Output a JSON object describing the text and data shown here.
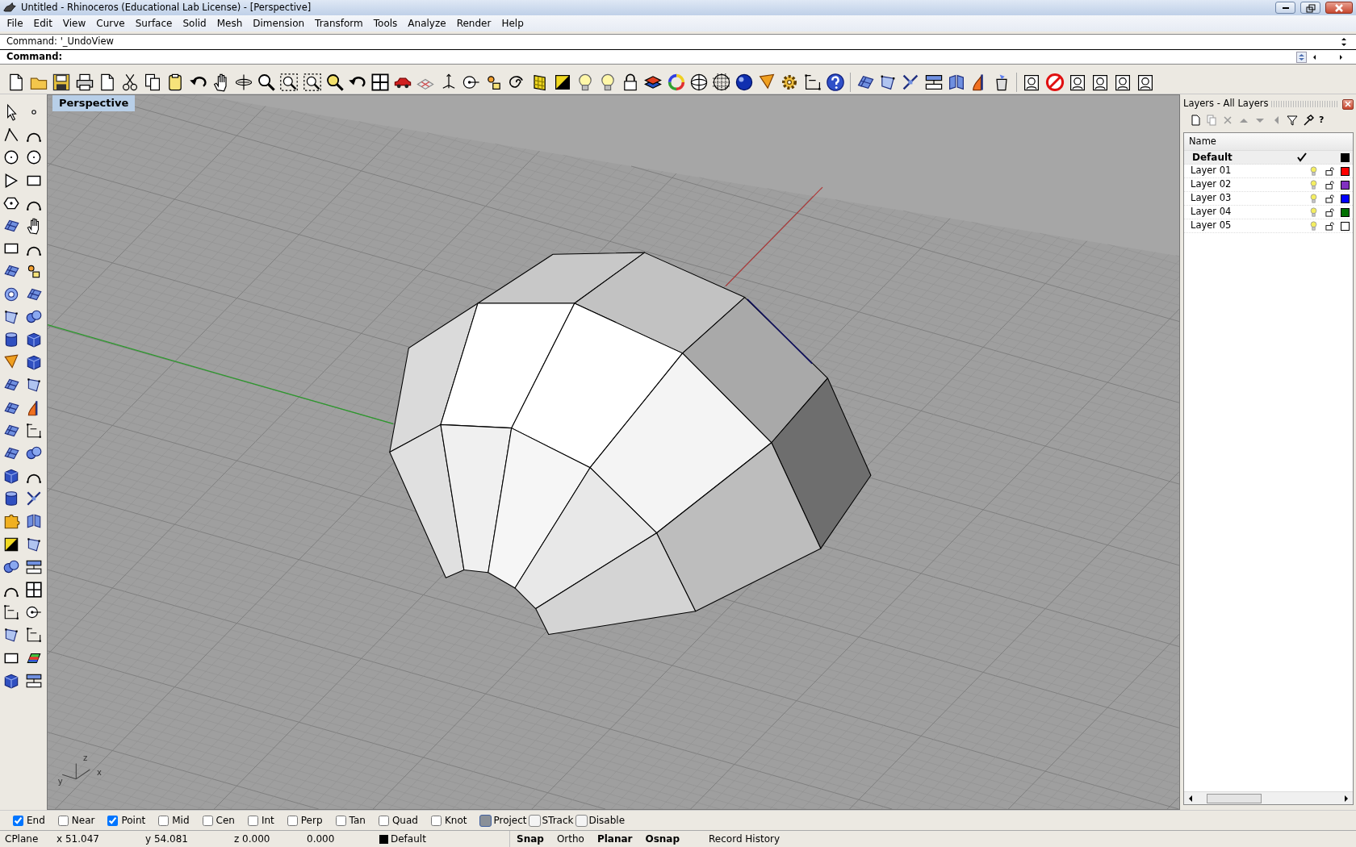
{
  "window": {
    "title": "Untitled - Rhinoceros (Educational Lab License) - [Perspective]"
  },
  "menu": [
    "File",
    "Edit",
    "View",
    "Curve",
    "Surface",
    "Solid",
    "Mesh",
    "Dimension",
    "Transform",
    "Tools",
    "Analyze",
    "Render",
    "Help"
  ],
  "command": {
    "history": "Command: '_UndoView",
    "prompt": "Command:"
  },
  "viewport": {
    "title": "Perspective",
    "axis_labels": [
      "z",
      "x",
      "y"
    ]
  },
  "layers": {
    "title": "Layers - All Layers",
    "help": "?",
    "column": "Name",
    "items": [
      {
        "name": "Default",
        "current": true,
        "color": "#000000"
      },
      {
        "name": "Layer 01",
        "current": false,
        "color": "#ff0000"
      },
      {
        "name": "Layer 02",
        "current": false,
        "color": "#8030c0"
      },
      {
        "name": "Layer 03",
        "current": false,
        "color": "#0000ff"
      },
      {
        "name": "Layer 04",
        "current": false,
        "color": "#007000"
      },
      {
        "name": "Layer 05",
        "current": false,
        "color": "#ffffff"
      }
    ]
  },
  "osnaps": [
    {
      "label": "End",
      "kind": "check",
      "checked": true
    },
    {
      "label": "Near",
      "kind": "check",
      "checked": false
    },
    {
      "label": "Point",
      "kind": "check",
      "checked": true
    },
    {
      "label": "Mid",
      "kind": "check",
      "checked": false
    },
    {
      "label": "Cen",
      "kind": "check",
      "checked": false
    },
    {
      "label": "Int",
      "kind": "check",
      "checked": false
    },
    {
      "label": "Perp",
      "kind": "check",
      "checked": false
    },
    {
      "label": "Tan",
      "kind": "check",
      "checked": false
    },
    {
      "label": "Quad",
      "kind": "check",
      "checked": false
    },
    {
      "label": "Knot",
      "kind": "check",
      "checked": false
    },
    {
      "label": "Project",
      "kind": "toggle",
      "checked": true
    },
    {
      "label": "STrack",
      "kind": "toggle",
      "checked": false
    },
    {
      "label": "Disable",
      "kind": "toggle",
      "checked": false
    }
  ],
  "status": {
    "cplane": "CPlane",
    "x": "x 51.047",
    "y": "y 54.081",
    "z": "z 0.000",
    "distance": "0.000",
    "layer": "Default",
    "toggles": [
      {
        "label": "Snap",
        "on": true
      },
      {
        "label": "Ortho",
        "on": false
      },
      {
        "label": "Planar",
        "on": true
      },
      {
        "label": "Osnap",
        "on": true
      },
      {
        "label": "Record History",
        "on": false
      }
    ]
  }
}
